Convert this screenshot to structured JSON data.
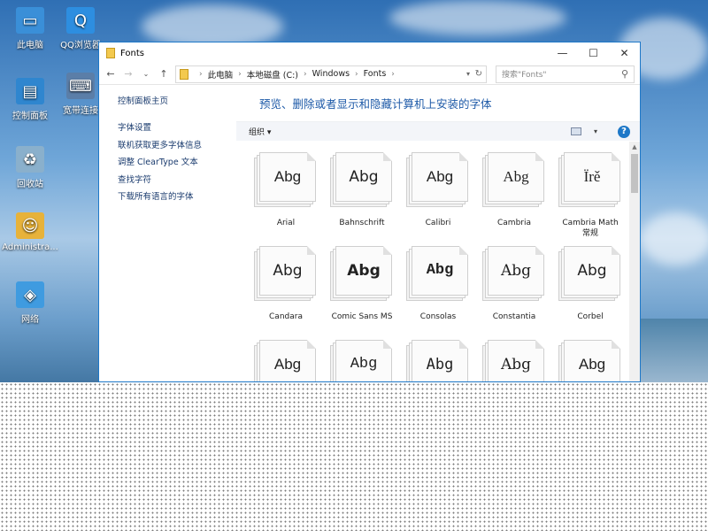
{
  "desktop": {
    "icons_left": [
      {
        "label": "此电脑",
        "icon": "computer-icon"
      },
      {
        "label": "控制面板",
        "icon": "control-panel-icon"
      },
      {
        "label": "回收站",
        "icon": "recycle-bin-icon"
      },
      {
        "label": "Administra...",
        "icon": "user-folder-icon"
      },
      {
        "label": "网络",
        "icon": "network-icon"
      }
    ],
    "icons_right": [
      {
        "label": "QQ浏览器",
        "icon": "qq-browser-icon"
      },
      {
        "label": "宽带连接",
        "icon": "broadband-icon"
      }
    ]
  },
  "window": {
    "title": "Fonts",
    "controls": {
      "minimize": "—",
      "maximize": "☐",
      "close": "✕"
    }
  },
  "address": {
    "path": [
      "此电脑",
      "本地磁盘 (C:)",
      "Windows",
      "Fonts"
    ],
    "separator": "›"
  },
  "search": {
    "placeholder": "搜索\"Fonts\""
  },
  "leftpane": {
    "home": "控制面板主页",
    "links": [
      "字体设置",
      "联机获取更多字体信息",
      "调整 ClearType 文本",
      "查找字符",
      "下载所有语言的字体"
    ]
  },
  "main": {
    "heading": "预览、删除或者显示和隐藏计算机上安装的字体",
    "organize_label": "组织 ▾",
    "help_label": "?"
  },
  "fonts": [
    {
      "name": "Arial",
      "sample": "Abg",
      "css": "\"Liberation Sans\", sans-serif"
    },
    {
      "name": "Bahnschrift",
      "sample": "Abg",
      "css": "\"DejaVu Sans\", sans-serif"
    },
    {
      "name": "Calibri",
      "sample": "Abg",
      "css": "\"Liberation Sans\", sans-serif"
    },
    {
      "name": "Cambria",
      "sample": "Abg",
      "css": "\"Liberation Serif\", serif"
    },
    {
      "name": "Cambria Math\n常规",
      "sample": "Ïrě",
      "css": "\"Liberation Serif\", serif"
    },
    {
      "name": "Candara",
      "sample": "Abg",
      "css": "\"DejaVu Sans\", sans-serif"
    },
    {
      "name": "Comic Sans MS",
      "sample": "Abg",
      "css": "\"DejaVu Sans\", sans-serif"
    },
    {
      "name": "Consolas",
      "sample": "Abg",
      "css": "\"Liberation Mono\", monospace"
    },
    {
      "name": "Constantia",
      "sample": "Abg",
      "css": "\"DejaVu Serif\", serif"
    },
    {
      "name": "Corbel",
      "sample": "Abg",
      "css": "\"DejaVu Sans\", sans-serif"
    },
    {
      "name": "",
      "sample": "Abg",
      "css": "\"Liberation Sans\", sans-serif"
    },
    {
      "name": "",
      "sample": "Abg",
      "css": "\"Liberation Mono\", monospace"
    },
    {
      "name": "",
      "sample": "Abg",
      "css": "\"DejaVu Sans Mono\", monospace"
    },
    {
      "name": "",
      "sample": "Abg",
      "css": "\"DejaVu Serif\", serif"
    },
    {
      "name": "",
      "sample": "Abg",
      "css": "\"Liberation Sans\", sans-serif"
    }
  ],
  "colors": {
    "accent": "#1e78c8",
    "heading": "#1e5aa8",
    "link": "#1a3b6e"
  }
}
